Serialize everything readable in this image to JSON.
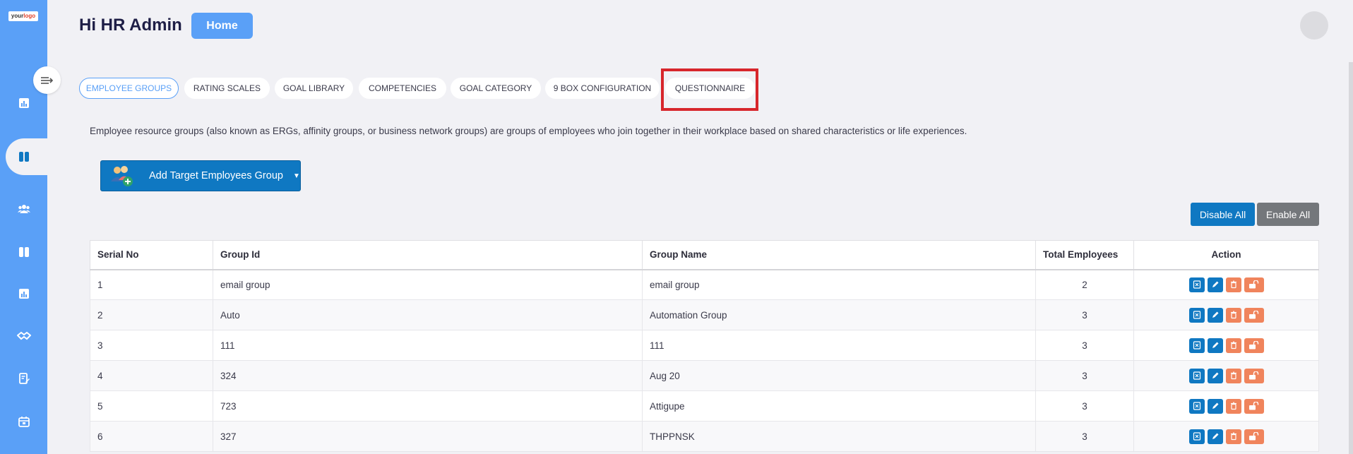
{
  "sidebar": {
    "logo_text": "your",
    "logo_accent": "logo",
    "icons": [
      "collapse-menu-icon",
      "dashboard-chart-icon",
      "grid-icon",
      "users-icon",
      "book-icon",
      "report-chart-icon",
      "handshake-icon",
      "edit-document-icon",
      "calendar-icon"
    ]
  },
  "header": {
    "greeting": "Hi HR Admin",
    "home_label": "Home"
  },
  "tabs": [
    {
      "label": "EMPLOYEE GROUPS",
      "active": true
    },
    {
      "label": "RATING SCALES"
    },
    {
      "label": "GOAL LIBRARY"
    },
    {
      "label": "COMPETENCIES"
    },
    {
      "label": "GOAL CATEGORY"
    },
    {
      "label": "9 BOX CONFIGURATION"
    },
    {
      "label": "QUESTIONNAIRE"
    }
  ],
  "description": "Employee resource groups (also known as ERGs, affinity groups, or business network groups) are groups of employees who join together in their workplace based on shared characteristics or life experiences.",
  "add_group_label": "Add Target Employees Group",
  "disable_all_label": "Disable All",
  "enable_all_label": "Enable All",
  "table": {
    "headers": [
      "Serial No",
      "Group Id",
      "Group Name",
      "Total Employees",
      "Action"
    ],
    "rows": [
      {
        "serial": "1",
        "group_id": "email group",
        "group_name": "email group",
        "total": "2"
      },
      {
        "serial": "2",
        "group_id": "Auto",
        "group_name": "Automation Group",
        "total": "3"
      },
      {
        "serial": "3",
        "group_id": "111",
        "group_name": "111",
        "total": "3"
      },
      {
        "serial": "4",
        "group_id": "324",
        "group_name": "Aug 20",
        "total": "3"
      },
      {
        "serial": "5",
        "group_id": "723",
        "group_name": "Attigupe",
        "total": "3"
      },
      {
        "serial": "6",
        "group_id": "327",
        "group_name": "THPPNSK",
        "total": "3"
      }
    ]
  },
  "colors": {
    "sidebar": "#5aa0f7",
    "primary": "#0f78c2",
    "danger_action": "#f0845c",
    "highlight": "#d7262c"
  }
}
